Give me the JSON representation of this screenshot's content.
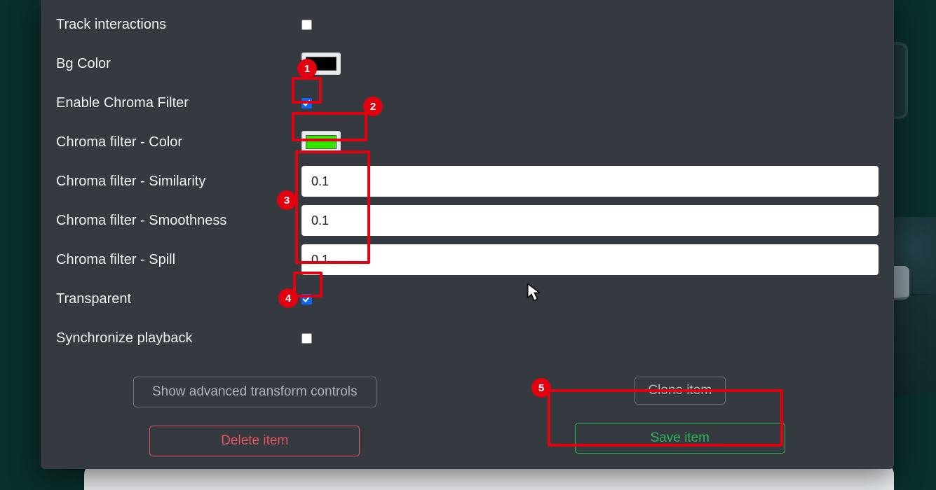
{
  "settings": {
    "track_interactions": {
      "label": "Track interactions",
      "checked": false
    },
    "bg_color": {
      "label": "Bg Color",
      "swatch": "#000000"
    },
    "enable_chroma": {
      "label": "Enable Chroma Filter",
      "checked": true
    },
    "chroma_color": {
      "label": "Chroma filter - Color",
      "swatch": "#33e600"
    },
    "chroma_similarity": {
      "label": "Chroma filter - Similarity",
      "value": "0.1"
    },
    "chroma_smoothness": {
      "label": "Chroma filter - Smoothness",
      "value": "0.1"
    },
    "chroma_spill": {
      "label": "Chroma filter - Spill",
      "value": "0.1"
    },
    "transparent": {
      "label": "Transparent",
      "checked": true
    },
    "sync_playback": {
      "label": "Synchronize playback",
      "checked": false
    }
  },
  "buttons": {
    "show_transform": "Show advanced transform controls",
    "delete_item": "Delete item",
    "clone_item": "Clone item",
    "save_item": "Save item"
  },
  "annotation_labels": {
    "b1": "1",
    "b2": "2",
    "b3": "3",
    "b4": "4",
    "b5": "5"
  }
}
